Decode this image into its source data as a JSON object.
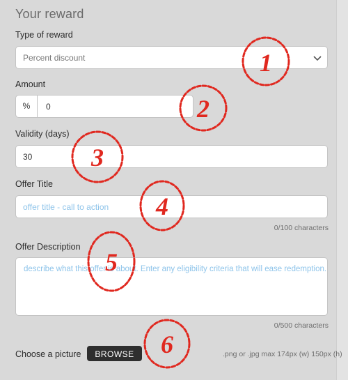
{
  "form": {
    "heading": "Your reward",
    "type_of_reward": {
      "label": "Type of reward",
      "value": "Percent discount"
    },
    "amount": {
      "label": "Amount",
      "unit": "%",
      "value": "0"
    },
    "validity": {
      "label": "Validity (days)",
      "value": "30"
    },
    "offer_title": {
      "label": "Offer Title",
      "placeholder": "offer title - call to action",
      "counter": "0/100 characters"
    },
    "offer_description": {
      "label": "Offer Description",
      "placeholder": "describe what this offer is about. Enter any eligibility criteria that will ease redemption.",
      "counter": "0/500  characters"
    },
    "picture": {
      "label": "Choose a picture",
      "button": "BROWSE",
      "hint": ".png or .jpg max 174px (w) 150px (h)"
    }
  },
  "annotations": [
    "1",
    "2",
    "3",
    "4",
    "5",
    "6"
  ],
  "colors": {
    "annotation_red": "#e0281f",
    "placeholder_blue": "#8ec4ea",
    "button_dark": "#2e2e2e"
  }
}
